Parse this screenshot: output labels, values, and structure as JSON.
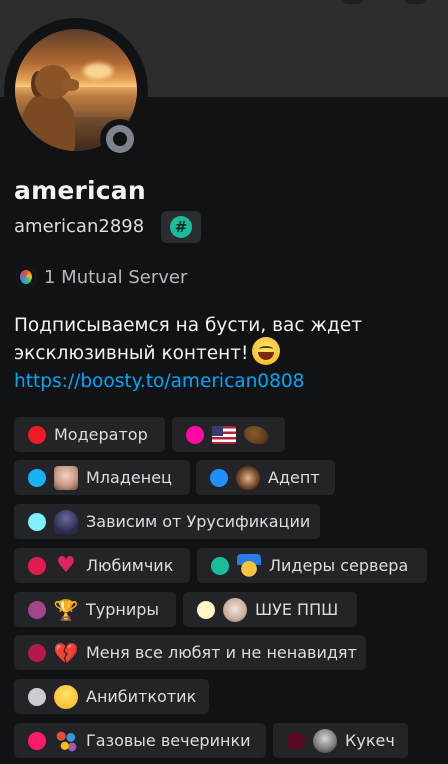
{
  "profile": {
    "display_name": "american",
    "username": "american2898",
    "mutual_servers": "1 Mutual Server",
    "status": "offline"
  },
  "bio": {
    "line1": "Подписываемся на бусти, вас ждет",
    "line2": "эксклюзивный контент!",
    "link": "https://boosty.to/american0808"
  },
  "roles": [
    {
      "name": "Модератор",
      "color": "#ed1c24",
      "emoji": ""
    },
    {
      "name": "",
      "color": "#ff0aa0",
      "emoji": "us-flag, eagle"
    },
    {
      "name": "Младенец",
      "color": "#1ab0f5",
      "emoji": "baby-photo"
    },
    {
      "name": "Адепт",
      "color": "#1e90ff",
      "emoji": "person-photo"
    },
    {
      "name": "Зависим от Урусификации",
      "color": "#7ff0ff",
      "emoji": "ninja"
    },
    {
      "name": "Любимчик",
      "color": "#e31b4d",
      "emoji": "sparkling-heart"
    },
    {
      "name": "Лидеры сервера",
      "color": "#1abc9c",
      "emoji": "medal"
    },
    {
      "name": "Турниры",
      "color": "#a2458a",
      "emoji": "trophy"
    },
    {
      "name": "ШУЕ ППШ",
      "color": "#fff6c8",
      "emoji": "pale-face"
    },
    {
      "name": "Меня все любят и не ненавидят",
      "color": "#b5184f",
      "emoji": "broken-heart"
    },
    {
      "name": "Анибиткотик",
      "color": "#c9cdd2",
      "emoji": "laughing-cat"
    },
    {
      "name": "Газовые вечеринки",
      "color": "#ff1a6e",
      "emoji": "bubbles"
    },
    {
      "name": "Кукеч",
      "color": "#5a0a24",
      "emoji": "monochrome-face"
    }
  ]
}
